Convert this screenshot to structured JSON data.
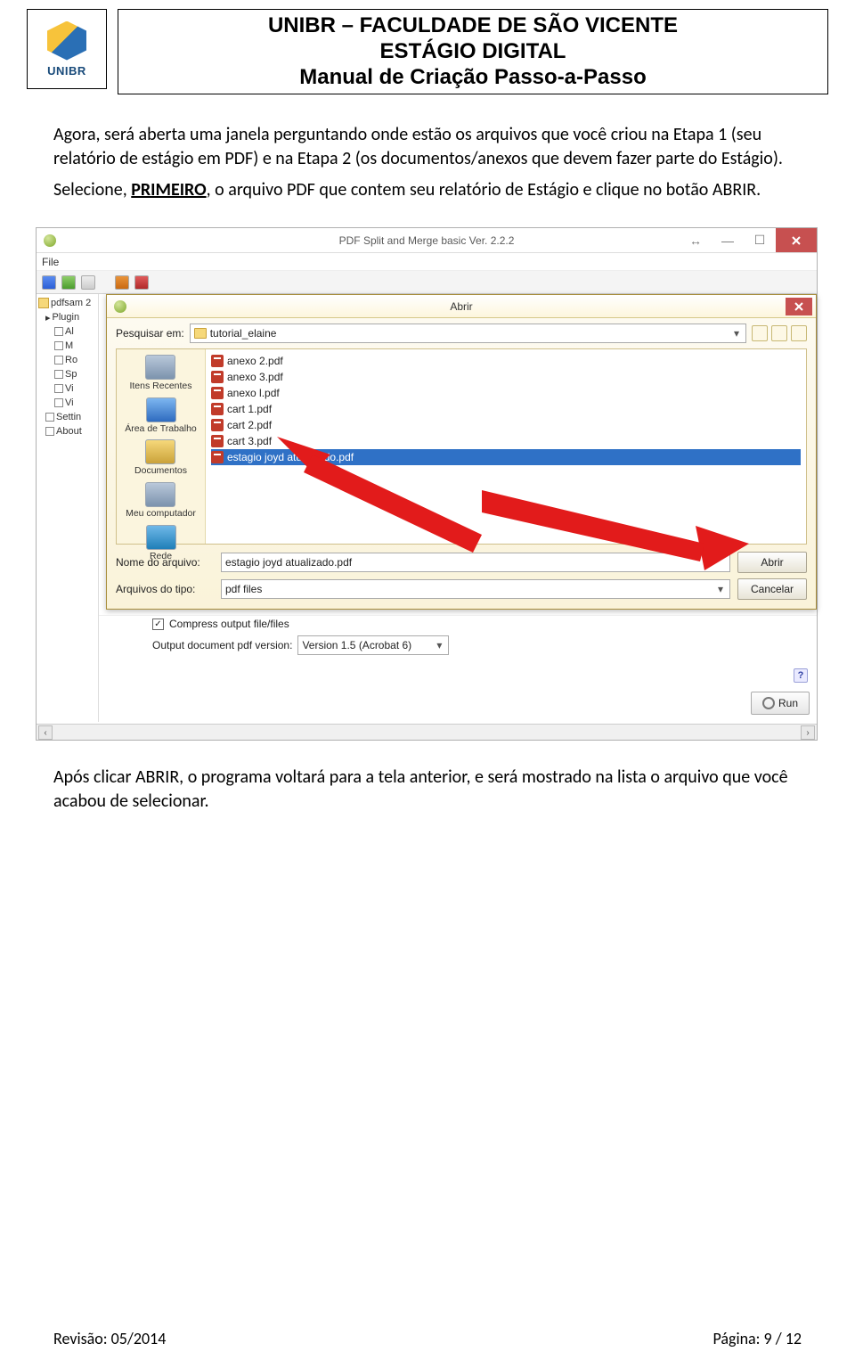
{
  "header": {
    "line1": "UNIBR – FACULDADE DE SÃO VICENTE",
    "line2": "ESTÁGIO DIGITAL",
    "line3": "Manual de Criação Passo-a-Passo",
    "logo_text": "UNIBR"
  },
  "body": {
    "p1a": "Agora, será aberta uma janela perguntando onde estão os arquivos que você criou na Etapa 1 (seu relatório de estágio em PDF) e na Etapa 2 (os documentos/anexos que devem fazer parte do Estágio).",
    "p2a": "Selecione, ",
    "p2b": "PRIMEIRO",
    "p2c": ", o arquivo PDF que contem seu relatório de Estágio e clique no botão ABRIR.",
    "post": "Após clicar ABRIR, o programa voltará para a tela anterior, e será mostrado na lista o arquivo que você acabou de selecionar."
  },
  "app": {
    "title": "PDF Split and Merge basic Ver. 2.2.2",
    "menu_file": "File",
    "tree": {
      "root": "pdfsam 2",
      "plugins": "Plugin",
      "items": [
        "Al",
        "M",
        "Ro",
        "Sp",
        "Vi",
        "Vi"
      ],
      "settings": "Settin",
      "about": "About"
    }
  },
  "dialog": {
    "title": "Abrir",
    "search_label": "Pesquisar em:",
    "folder": "tutorial_elaine",
    "places": {
      "recent": "Itens Recentes",
      "desktop": "Área de Trabalho",
      "docs": "Documentos",
      "pc": "Meu computador",
      "net": "Rede"
    },
    "files": [
      "anexo 2.pdf",
      "anexo 3.pdf",
      "anexo l.pdf",
      "cart 1.pdf",
      "cart 2.pdf",
      "cart 3.pdf",
      "estagio joyd atualizado.pdf"
    ],
    "filename_label": "Nome do arquivo:",
    "filename_value": "estagio joyd atualizado.pdf",
    "filetype_label": "Arquivos do tipo:",
    "filetype_value": "pdf files",
    "open_btn": "Abrir",
    "cancel_btn": "Cancelar"
  },
  "below": {
    "compress": "Compress output file/files",
    "version_label": "Output document pdf version:",
    "version_value": "Version 1.5 (Acrobat 6)",
    "run": "Run"
  },
  "footer": {
    "left": "Revisão: 05/2014",
    "right": "Página: 9 / 12"
  }
}
